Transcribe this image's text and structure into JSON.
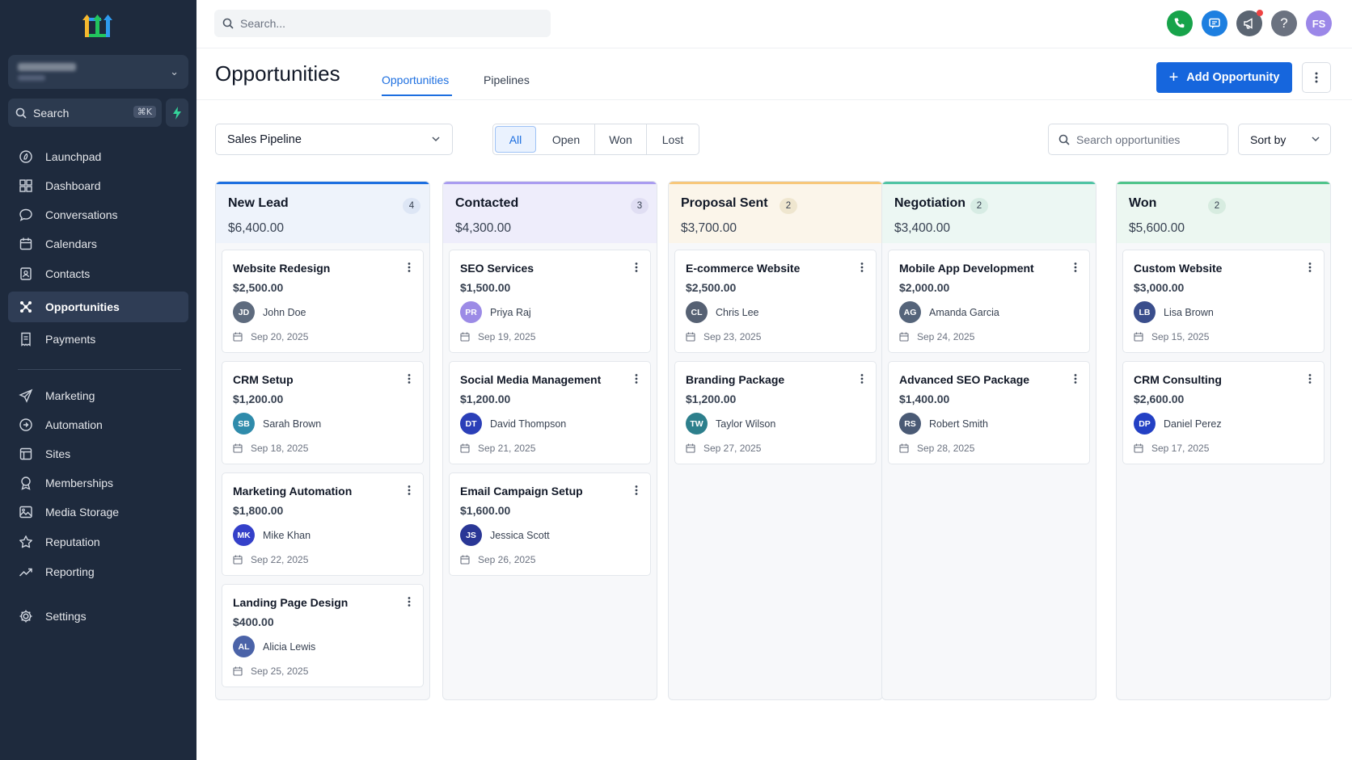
{
  "sidebar": {
    "search_label": "Search",
    "search_shortcut": "⌘K",
    "nav_main": [
      {
        "label": "Launchpad",
        "icon": "launchpad-icon"
      },
      {
        "label": "Dashboard",
        "icon": "dashboard-icon"
      },
      {
        "label": "Conversations",
        "icon": "chat-bubble-icon"
      },
      {
        "label": "Calendars",
        "icon": "calendar-icon"
      },
      {
        "label": "Contacts",
        "icon": "contacts-icon"
      },
      {
        "label": "Opportunities",
        "icon": "opportunities-icon",
        "active": true
      },
      {
        "label": "Payments",
        "icon": "receipt-icon"
      }
    ],
    "nav_secondary": [
      {
        "label": "Marketing",
        "icon": "send-icon"
      },
      {
        "label": "Automation",
        "icon": "automation-icon"
      },
      {
        "label": "Sites",
        "icon": "sites-icon"
      },
      {
        "label": "Memberships",
        "icon": "award-icon"
      },
      {
        "label": "Media Storage",
        "icon": "image-icon"
      },
      {
        "label": "Reputation",
        "icon": "star-icon"
      },
      {
        "label": "Reporting",
        "icon": "trend-icon"
      }
    ],
    "settings_label": "Settings"
  },
  "topbar": {
    "search_placeholder": "Search...",
    "avatar_initials": "FS",
    "colors": {
      "phone": "#17a34a",
      "chat": "#1d7fe0",
      "announce": "#5b6572",
      "help": "#6b7280",
      "avatar": "#9b87e8"
    }
  },
  "header": {
    "title": "Opportunities",
    "tabs": [
      {
        "label": "Opportunities",
        "active": true
      },
      {
        "label": "Pipelines",
        "active": false
      }
    ],
    "add_button_label": "Add Opportunity"
  },
  "filters": {
    "pipeline": "Sales Pipeline",
    "status_options": [
      "All",
      "Open",
      "Won",
      "Lost"
    ],
    "status_selected": "All",
    "search_placeholder": "Search opportunities",
    "sort_label": "Sort by"
  },
  "columns": [
    {
      "name": "New Lead",
      "count": "4",
      "amount": "$6,400.00",
      "accent": "#1d6fe0",
      "head_bg": "#eef3fb",
      "count_bg": "#dde6f5",
      "cards": [
        {
          "title": "Website Redesign",
          "amount": "$2,500.00",
          "initials": "JD",
          "avatar_color": "#5e6b7e",
          "user": "John Doe",
          "date": "Sep 20, 2025"
        },
        {
          "title": "CRM Setup",
          "amount": "$1,200.00",
          "initials": "SB",
          "avatar_color": "#2f8bab",
          "user": "Sarah Brown",
          "date": "Sep 18, 2025"
        },
        {
          "title": "Marketing Automation",
          "amount": "$1,800.00",
          "initials": "MK",
          "avatar_color": "#3440c9",
          "user": "Mike Khan",
          "date": "Sep 22, 2025"
        },
        {
          "title": "Landing Page Design",
          "amount": "$400.00",
          "initials": "AL",
          "avatar_color": "#4b63a8",
          "user": "Alicia Lewis",
          "date": "Sep 25, 2025"
        }
      ]
    },
    {
      "name": "Contacted",
      "count": "3",
      "amount": "$4,300.00",
      "accent": "#a99cf0",
      "head_bg": "#eeedfb",
      "count_bg": "#e0def3",
      "cards": [
        {
          "title": "SEO Services",
          "amount": "$1,500.00",
          "initials": "PR",
          "avatar_color": "#9c8be6",
          "user": "Priya Raj",
          "date": "Sep 19, 2025"
        },
        {
          "title": "Social Media Management",
          "amount": "$1,200.00",
          "initials": "DT",
          "avatar_color": "#2b3fb8",
          "user": "David Thompson",
          "date": "Sep 21, 2025"
        },
        {
          "title": "Email Campaign Setup",
          "amount": "$1,600.00",
          "initials": "JS",
          "avatar_color": "#2a3796",
          "user": "Jessica Scott",
          "date": "Sep 26, 2025"
        }
      ]
    },
    {
      "name": "Proposal Sent",
      "count": "2",
      "amount": "$3,700.00",
      "accent": "#f7c77a",
      "head_bg": "#fbf5ea",
      "count_bg": "#efe6cf",
      "cards": [
        {
          "title": "E-commerce Website",
          "amount": "$2,500.00",
          "initials": "CL",
          "avatar_color": "#566173",
          "user": "Chris Lee",
          "date": "Sep 23, 2025"
        },
        {
          "title": "Branding Package",
          "amount": "$1,200.00",
          "initials": "TW",
          "avatar_color": "#2d7f8c",
          "user": "Taylor Wilson",
          "date": "Sep 27, 2025"
        }
      ]
    },
    {
      "name": "Negotiation",
      "count": "2",
      "amount": "$3,400.00",
      "accent": "#4fc4a4",
      "head_bg": "#ecf7f3",
      "count_bg": "#d7ece4",
      "cards": [
        {
          "title": "Mobile App Development",
          "amount": "$2,000.00",
          "initials": "AG",
          "avatar_color": "#55647a",
          "user": "Amanda Garcia",
          "date": "Sep 24, 2025"
        },
        {
          "title": "Advanced SEO Package",
          "amount": "$1,400.00",
          "initials": "RS",
          "avatar_color": "#4a5a75",
          "user": "Robert Smith",
          "date": "Sep 28, 2025"
        }
      ]
    },
    {
      "name": "Won",
      "count": "2",
      "amount": "$5,600.00",
      "accent": "#4fc48a",
      "head_bg": "#ecf7f1",
      "count_bg": "#d7ece0",
      "cards": [
        {
          "title": "Custom Website",
          "amount": "$3,000.00",
          "initials": "LB",
          "avatar_color": "#3a4e8c",
          "user": "Lisa Brown",
          "date": "Sep 15, 2025"
        },
        {
          "title": "CRM Consulting",
          "amount": "$2,600.00",
          "initials": "DP",
          "avatar_color": "#2340c4",
          "user": "Daniel Perez",
          "date": "Sep 17, 2025"
        }
      ]
    }
  ]
}
